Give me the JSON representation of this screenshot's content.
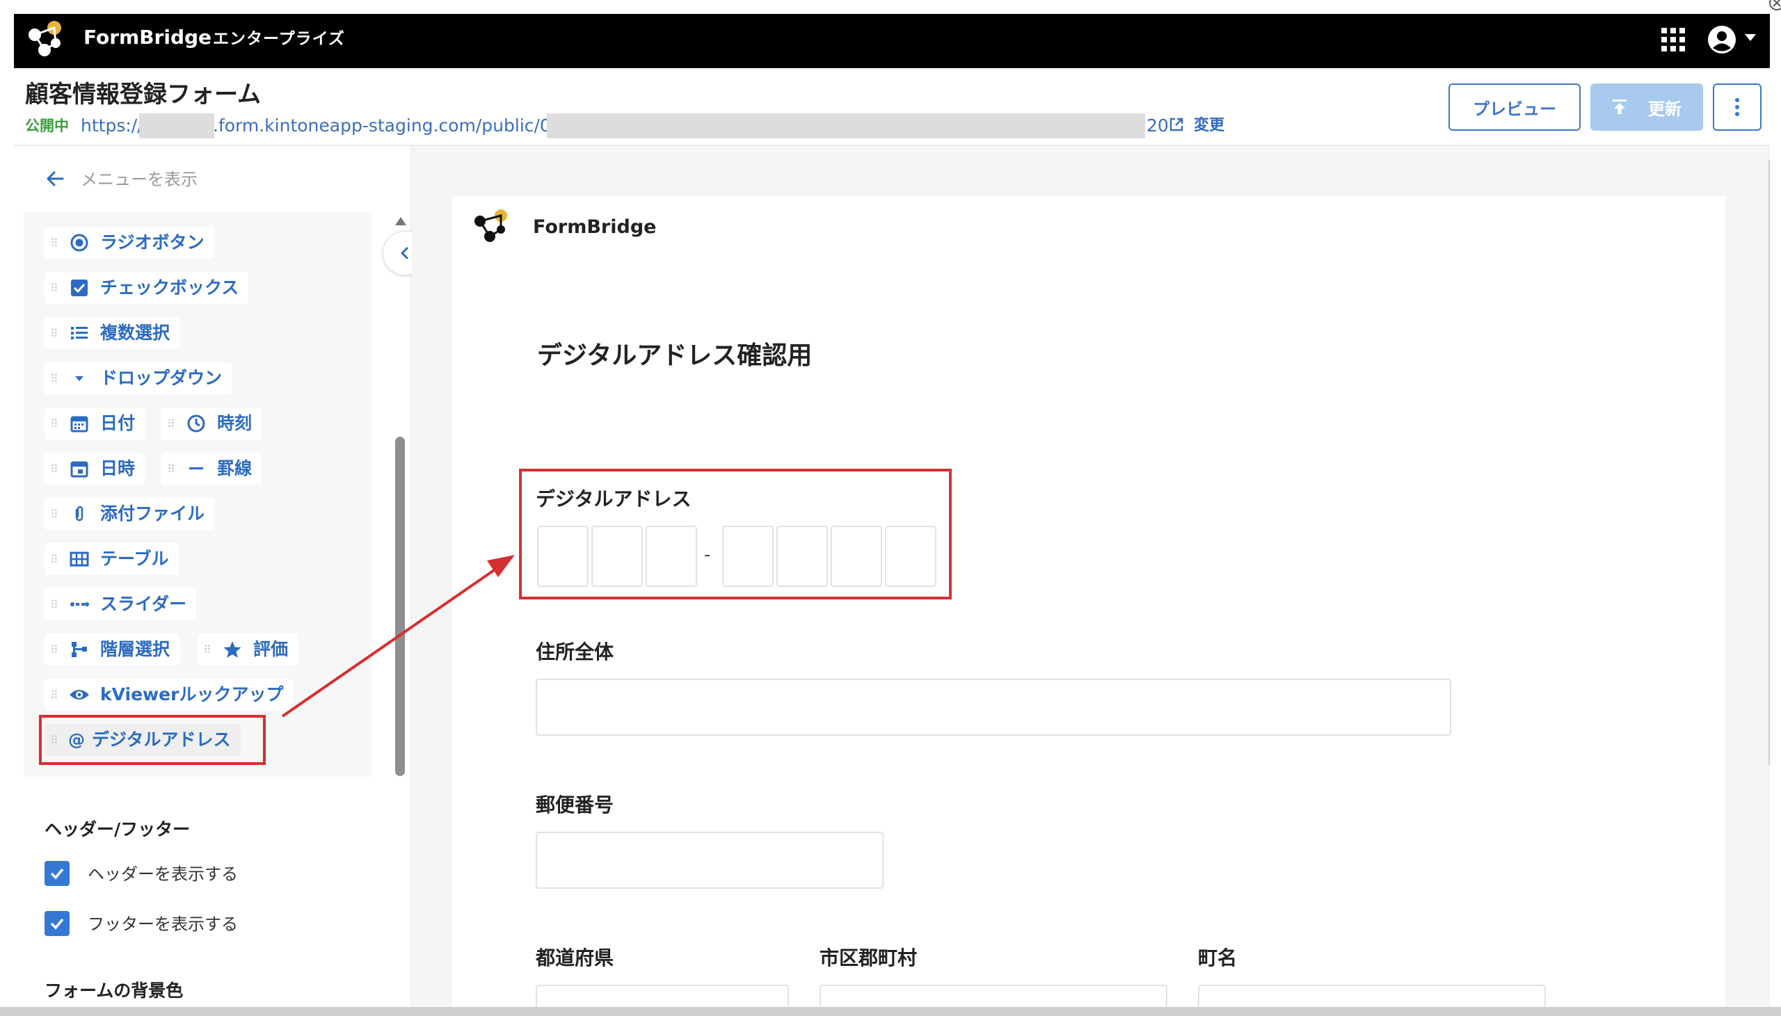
{
  "topbar": {
    "brand": "FormBridge",
    "edition": "エンタープライズ",
    "icons": [
      "formbridge-logo-icon",
      "apps-grid-icon",
      "account-circle-icon",
      "caret-down-icon"
    ]
  },
  "header": {
    "form_title": "顧客情報登録フォーム",
    "status": "公開中",
    "url": {
      "prefix": "https://",
      "middle": ".form.kintoneapp-staging.com/public/0",
      "suffix": "20"
    },
    "change_label": "変更",
    "buttons": {
      "preview": "プレビュー",
      "update": "更新"
    }
  },
  "sidebar": {
    "show_menu": "メニューを表示",
    "fields": [
      {
        "label": "ラジオボタン",
        "icon": "radio-icon"
      },
      {
        "label": "チェックボックス",
        "icon": "checkbox-icon"
      },
      {
        "label": "複数選択",
        "icon": "list-icon"
      },
      {
        "label": "ドロップダウン",
        "icon": "dropdown-icon"
      },
      {
        "label": "日付",
        "icon": "calendar-icon"
      },
      {
        "label": "時刻",
        "icon": "clock-icon"
      },
      {
        "label": "日時",
        "icon": "datetime-icon"
      },
      {
        "label": "罫線",
        "icon": "rule-icon"
      },
      {
        "label": "添付ファイル",
        "icon": "paperclip-icon"
      },
      {
        "label": "テーブル",
        "icon": "table-icon"
      },
      {
        "label": "スライダー",
        "icon": "slider-icon"
      },
      {
        "label": "階層選択",
        "icon": "hierarchy-icon"
      },
      {
        "label": "評価",
        "icon": "star-icon"
      },
      {
        "label": "kViewerルックアップ",
        "icon": "eye-icon"
      },
      {
        "label": "デジタルアドレス",
        "icon": "at-sign-icon"
      }
    ],
    "header_footer": {
      "heading": "ヘッダー/フッター",
      "show_header": {
        "label": "ヘッダーを表示する",
        "checked": true
      },
      "show_footer": {
        "label": "フッターを表示する",
        "checked": true
      }
    },
    "background_heading": "フォームの背景色"
  },
  "form": {
    "brand": "FormBridge",
    "heading": "デジタルアドレス確認用",
    "digital_address": {
      "label": "デジタルアドレス",
      "separator": "-"
    },
    "address_label": "住所全体",
    "zip_label": "郵便番号",
    "prefecture_label": "都道府県",
    "city_label": "市区郡町村",
    "town_label": "町名"
  },
  "colors": {
    "accent": "#2c6bc1",
    "topbar": "#000000",
    "status_green": "#3a9c3a",
    "highlight_red": "#d62f2f",
    "update_disabled": "#a7caee"
  }
}
